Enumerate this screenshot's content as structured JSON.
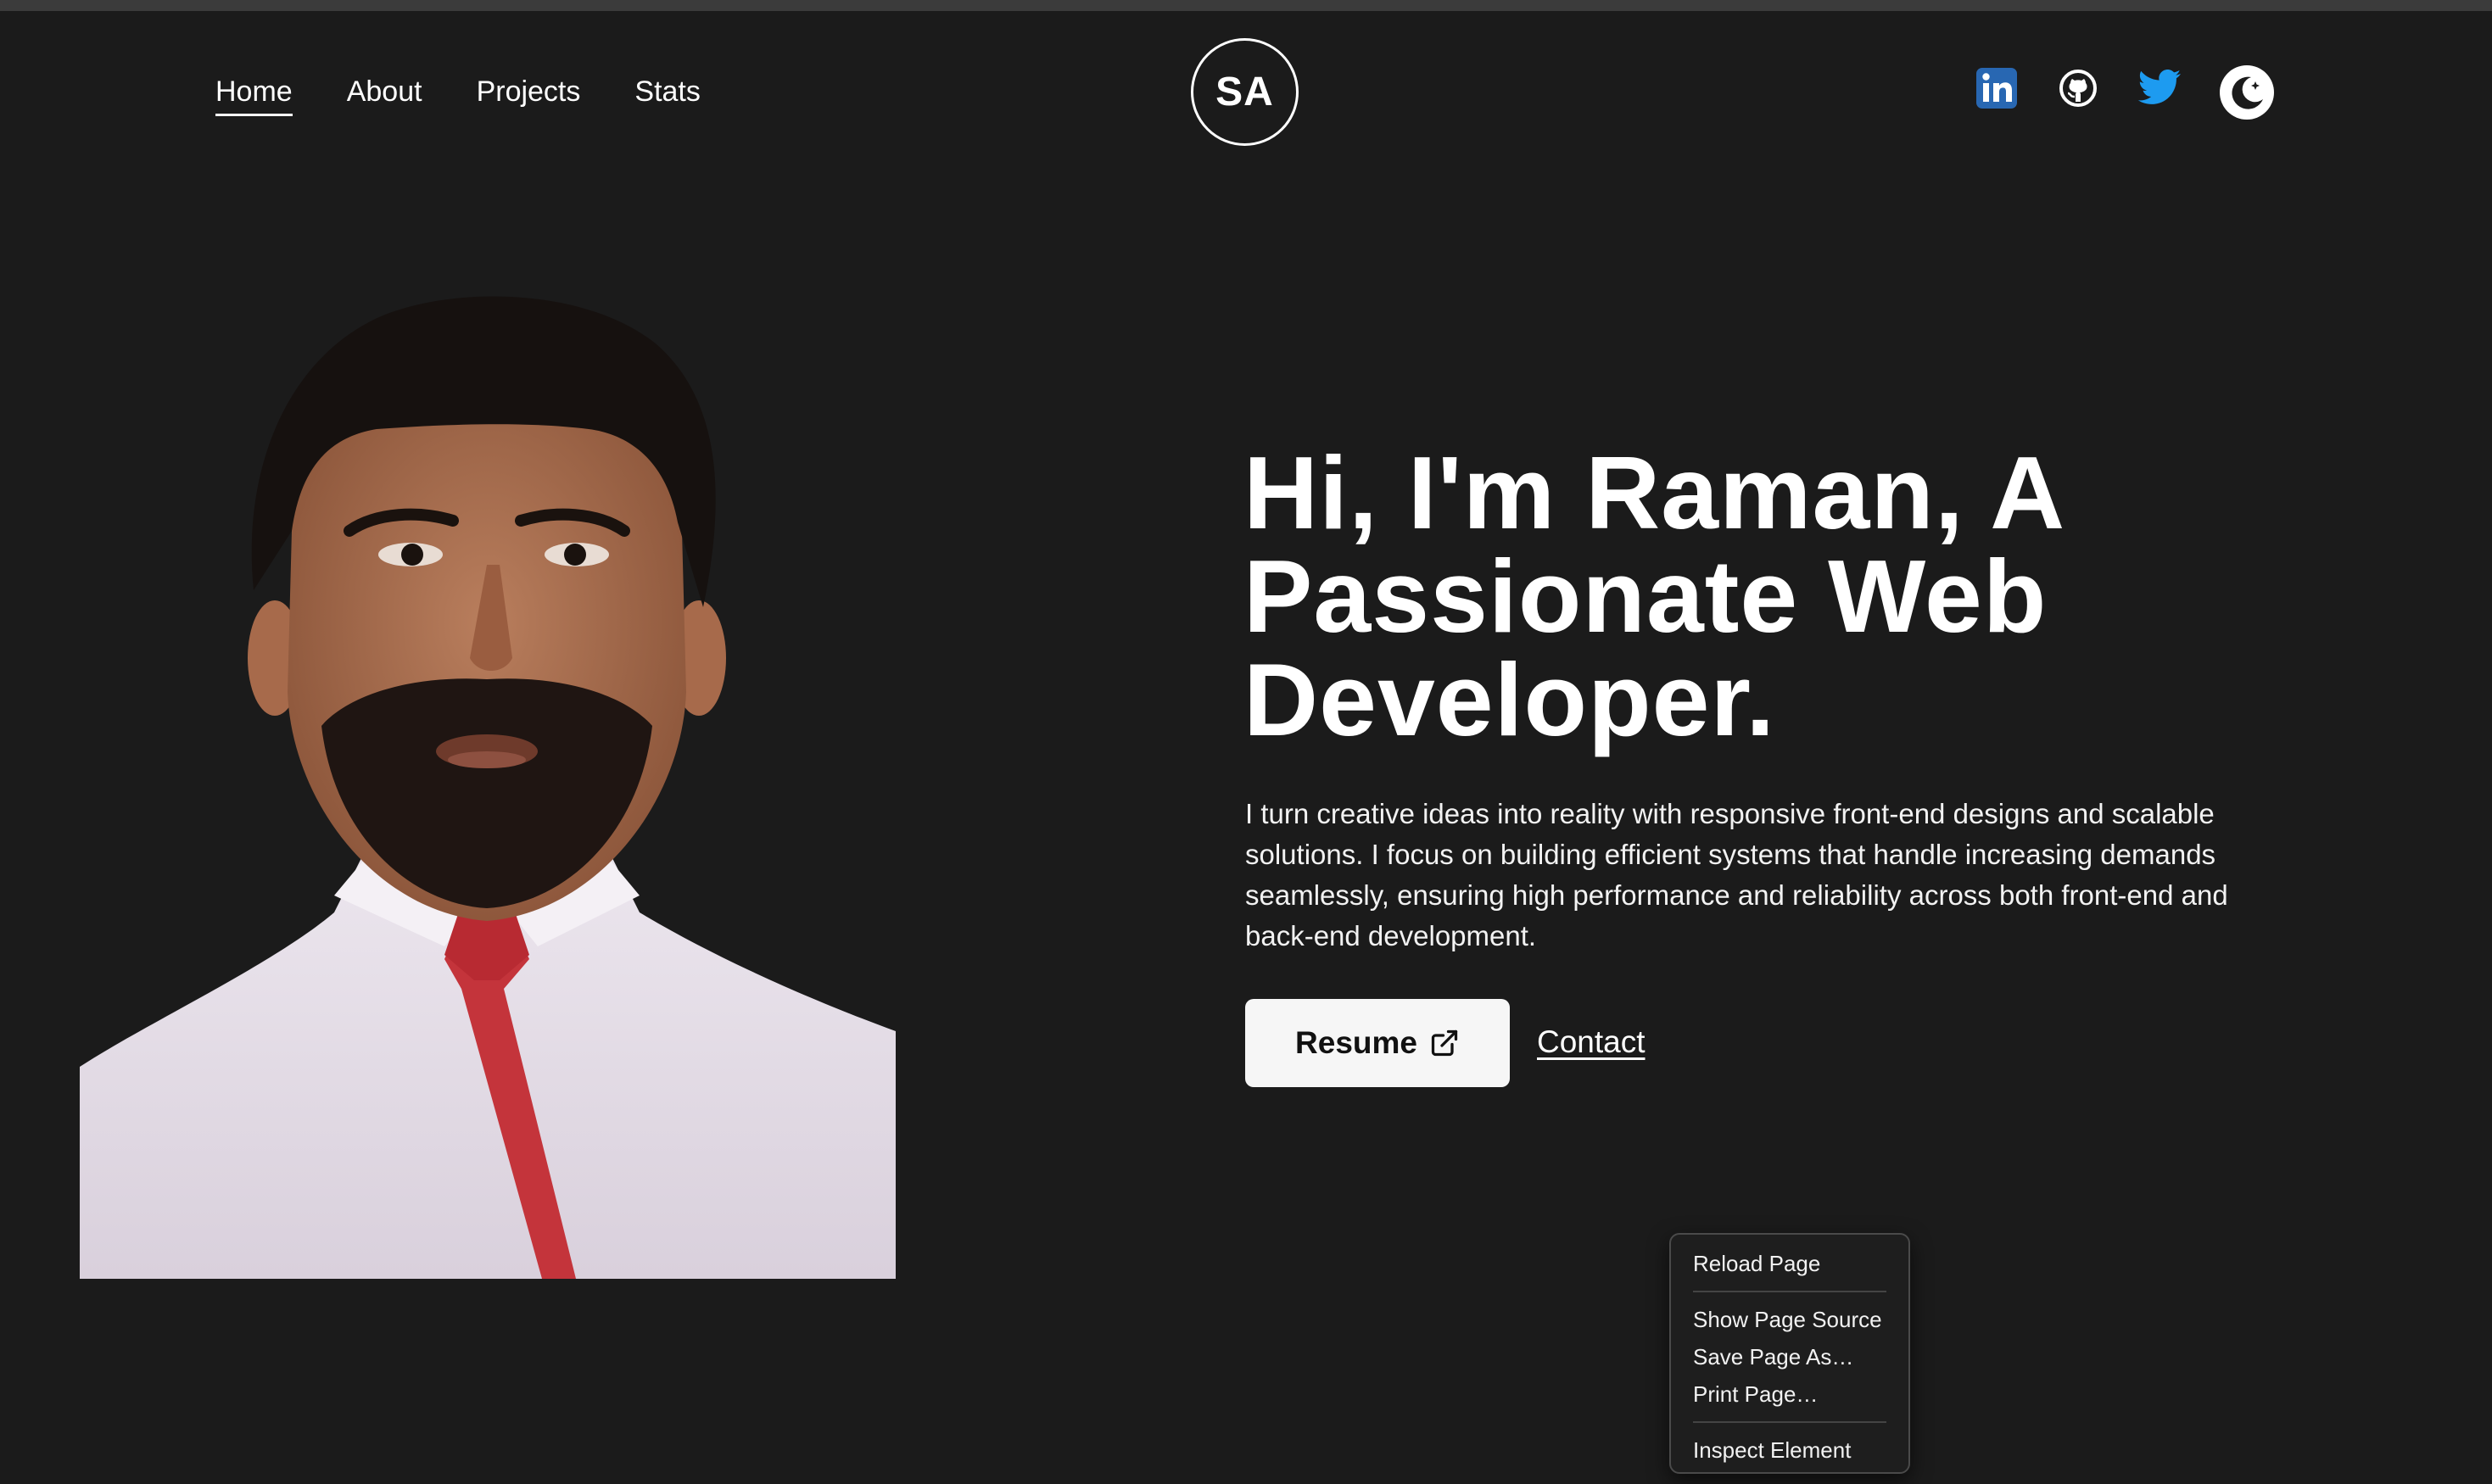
{
  "nav": {
    "items": [
      {
        "label": "Home",
        "active": true
      },
      {
        "label": "About"
      },
      {
        "label": "Projects"
      },
      {
        "label": "Stats"
      }
    ]
  },
  "logo": {
    "text": "SA"
  },
  "social": {
    "icons": [
      "linkedin-icon",
      "github-icon",
      "twitter-icon",
      "theme-toggle-icon"
    ],
    "colors": {
      "linkedin": "#2867b2",
      "twitter": "#1d9bf0",
      "github": "#ffffff"
    }
  },
  "hero": {
    "headline_lines": [
      "Hi, I'm Raman, A",
      "Passionate Web",
      "Developer."
    ],
    "intro_lines": [
      "I turn creative ideas into reality with responsive front-end designs and scalable",
      "solutions. I focus on building efficient systems that handle increasing demands",
      "seamlessly, ensuring high performance and reliability across both front-end and",
      "back-end development."
    ],
    "resume_label": "Resume",
    "contact_label": "Contact"
  },
  "context_menu": {
    "items": [
      "Reload Page",
      "Show Page Source",
      "Save Page As…",
      "Print Page…",
      "Inspect Element"
    ]
  },
  "colors": {
    "background": "#1b1b1b",
    "text": "#ffffff",
    "button_bg": "#f6f6f6"
  }
}
